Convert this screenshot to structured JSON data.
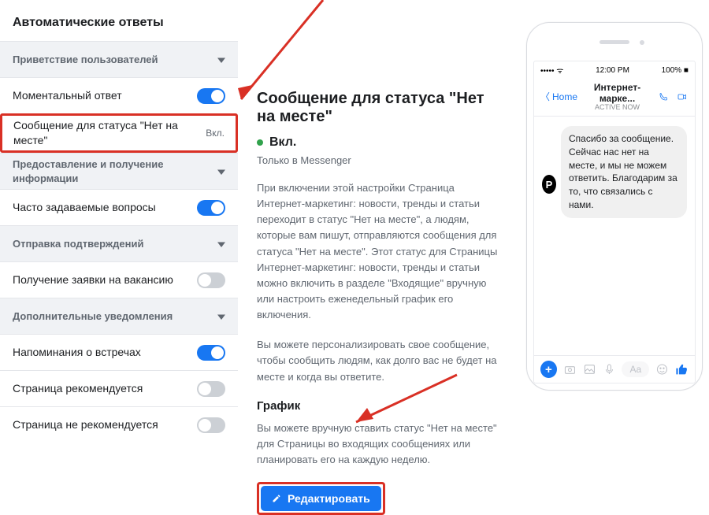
{
  "sidebar": {
    "title": "Автоматические ответы",
    "sections": [
      {
        "label": "Приветствие пользователей"
      },
      {
        "label": "Предоставление и получение информации"
      },
      {
        "label": "Отправка подтверждений"
      },
      {
        "label": "Дополнительные уведомления"
      }
    ],
    "rows": {
      "instant": {
        "label": "Моментальный ответ",
        "on": "on"
      },
      "away": {
        "label": "Сообщение для статуса \"Нет на месте\"",
        "status": "Вкл."
      },
      "faq": {
        "label": "Часто задаваемые вопросы",
        "on": "on"
      },
      "job": {
        "label": "Получение заявки на вакансию",
        "on": "off"
      },
      "remind": {
        "label": "Напоминания о встречах",
        "on": "on"
      },
      "recYes": {
        "label": "Страница рекомендуется",
        "on": "off"
      },
      "recNo": {
        "label": "Страница не рекомендуется",
        "on": "off"
      }
    }
  },
  "center": {
    "heading": "Сообщение для статуса \"Нет на месте\"",
    "statusLabel": "Вкл.",
    "subnote": "Только в Messenger",
    "para1": "При включении этой настройки Страница Интернет-маркетинг: новости, тренды и статьи переходит в статус \"Нет на месте\", а людям, которые вам пишут, отправляются сообщения для статуса \"Нет на месте\". Этот статус для Страницы Интернет-маркетинг: новости, тренды и статьи можно включить в разделе \"Входящие\" вручную или настроить еженедельный график его включения.",
    "para2": "Вы можете персонализировать свое сообщение, чтобы сообщить людям, как долго вас не будет на месте и когда вы ответите.",
    "scheduleHeading": "График",
    "schedulePara": "Вы можете вручную ставить статус \"Нет на месте\" для Страницы во входящих сообщениях или планировать его на каждую неделю.",
    "button": "Редактировать"
  },
  "phone": {
    "time": "12:00 PM",
    "battery": "100%",
    "back": "Home",
    "title": "Интернет-марке...",
    "subtitle": "ACTIVE NOW",
    "message": "Спасибо за сообщение. Сейчас нас нет на месте, и мы не можем ответить. Благодарим за то, что связались с нами.",
    "placeholder": "Aa"
  }
}
